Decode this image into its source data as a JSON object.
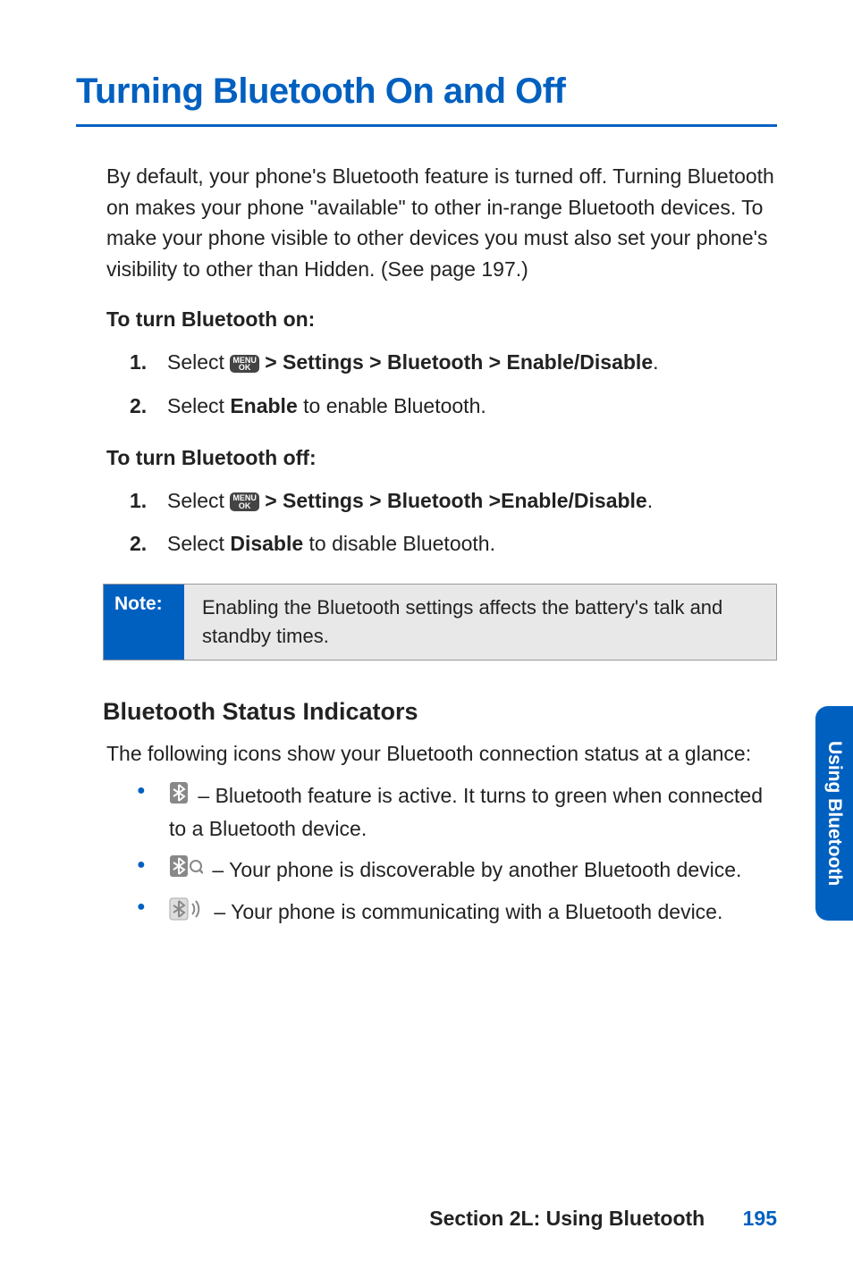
{
  "title": "Turning Bluetooth On and Off",
  "intro": "By default, your phone's Bluetooth feature is turned off. Turning Bluetooth on makes your phone \"available\" to other in-range Bluetooth devices. To make your phone visible to other devices you must also set your phone's visibility to other than Hidden. (See page 197.)",
  "on_head": "To turn Bluetooth on:",
  "on_steps": {
    "s1_pre": "Select ",
    "s1_path": " > Settings > Bluetooth > Enable/Disable",
    "s1_post": ".",
    "s2_pre": "Select ",
    "s2_bold": "Enable",
    "s2_post": " to enable Bluetooth."
  },
  "off_head": "To turn Bluetooth off:",
  "off_steps": {
    "s1_pre": "Select ",
    "s1_path": " > Settings > Bluetooth >Enable/Disable",
    "s1_post": ".",
    "s2_pre": "Select ",
    "s2_bold": "Disable",
    "s2_post": " to disable Bluetooth."
  },
  "note_label": "Note:",
  "note_text": "Enabling the Bluetooth settings affects the battery's talk and standby times.",
  "status_head": "Bluetooth Status Indicators",
  "status_intro": "The following icons show your Bluetooth connection status at a glance:",
  "indicators": {
    "i1": " – Bluetooth feature is active. It turns to green when connected to a Bluetooth device.",
    "i2": " – Your phone is discoverable by another Bluetooth device.",
    "i3": " – Your phone is communicating with a Bluetooth device."
  },
  "menu_key": {
    "top": "MENU",
    "bot": "OK"
  },
  "side_tab": "Using Bluetooth",
  "footer_section": "Section 2L: Using Bluetooth",
  "footer_page": "195"
}
